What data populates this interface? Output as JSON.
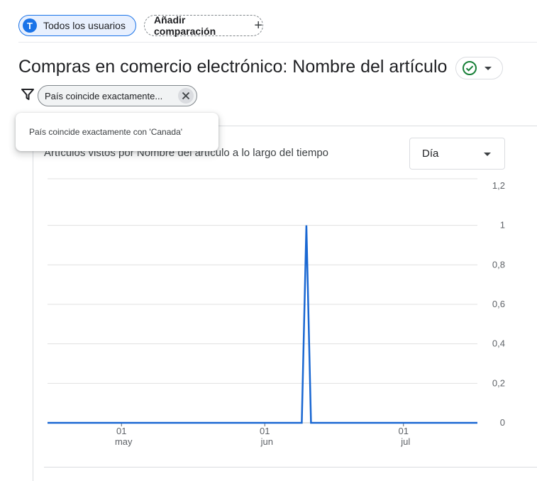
{
  "header": {
    "user_avatar_letter": "T",
    "user_segment_label": "Todos los usuarios",
    "add_comparison_label": "Añadir comparación",
    "add_icon": "plus-icon"
  },
  "report": {
    "title": "Compras en comercio electrónico: Nombre del artículo",
    "status_icon": "check-circle-icon"
  },
  "filter": {
    "chip_label": "País coincide exactamente...",
    "tooltip": "País coincide exactamente con 'Canada'"
  },
  "card": {
    "title": "Artículos vistos por Nombre del artículo a lo largo del tiempo",
    "granularity_selected": "Día"
  },
  "colors": {
    "accent": "#1a73e8",
    "series": "#1967d2",
    "success": "#188038"
  },
  "chart_data": {
    "type": "line",
    "x_ticks": [
      {
        "day": 1,
        "day_label": "01",
        "month_label": "may"
      },
      {
        "day": 32,
        "day_label": "01",
        "month_label": "jun"
      },
      {
        "day": 62,
        "day_label": "01",
        "month_label": "jul"
      }
    ],
    "x_range": [
      -15,
      78
    ],
    "y_ticks": [
      "0",
      "0,2",
      "0,4",
      "0,6",
      "0,8",
      "1",
      "1,2"
    ],
    "y_tick_values": [
      0,
      0.2,
      0.4,
      0.6,
      0.8,
      1,
      1.2
    ],
    "ylim": [
      0,
      1.2
    ],
    "grid": true,
    "y_axis_side": "right",
    "series": [
      {
        "x": [
          -15,
          40,
          41,
          42,
          78
        ],
        "y": [
          0,
          0,
          1,
          0,
          0
        ]
      }
    ]
  }
}
